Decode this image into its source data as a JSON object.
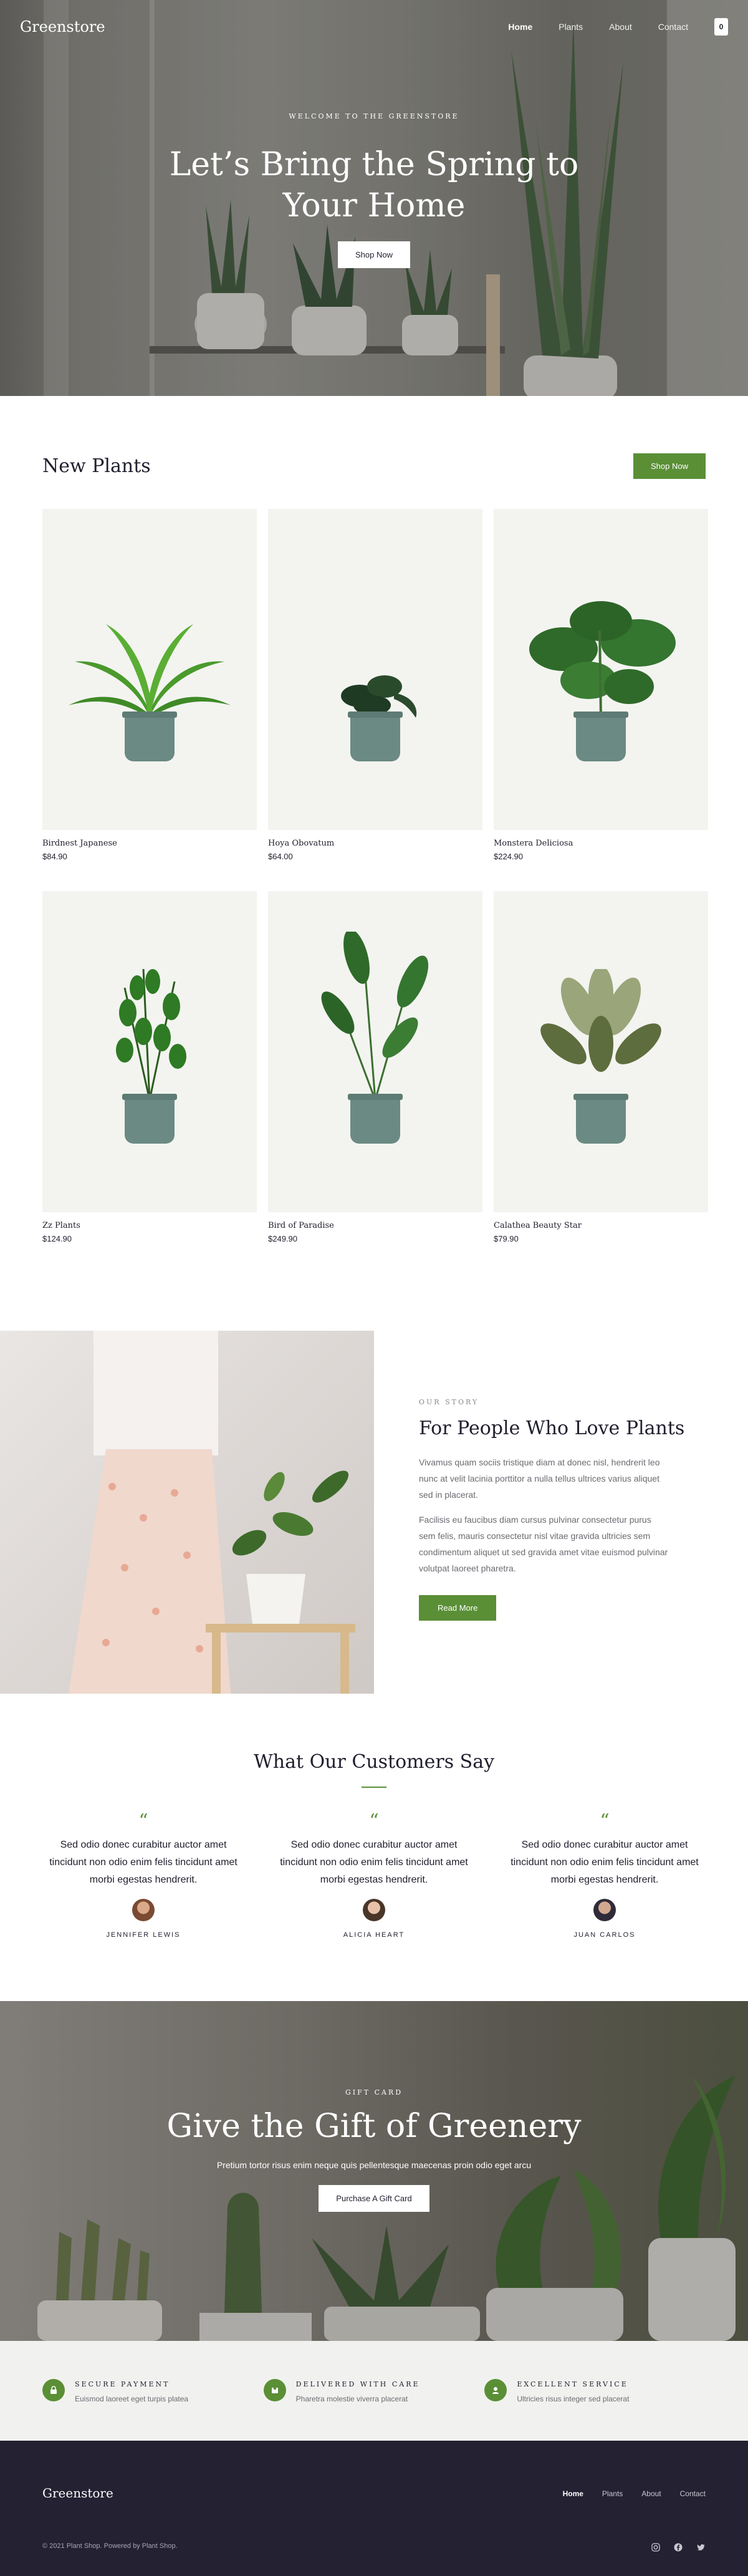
{
  "brand": {
    "logo": "Greenstore",
    "accent": "#5a8f36"
  },
  "nav": {
    "items": [
      {
        "label": "Home",
        "active": true
      },
      {
        "label": "Plants",
        "active": false
      },
      {
        "label": "About",
        "active": false
      },
      {
        "label": "Contact",
        "active": false
      }
    ],
    "cart_count": "0"
  },
  "hero": {
    "eyebrow": "WELCOME TO THE GREENSTORE",
    "title_line1": "Let’s Bring the Spring to",
    "title_line2": "Your Home",
    "button": "Shop Now"
  },
  "new_plants": {
    "title": "New Plants",
    "button": "Shop Now",
    "products": [
      {
        "name": "Birdnest Japanese",
        "price": "$84.90"
      },
      {
        "name": "Hoya Obovatum",
        "price": "$64.00"
      },
      {
        "name": "Monstera Deliciosa",
        "price": "$224.90"
      },
      {
        "name": "Zz Plants",
        "price": "$124.90"
      },
      {
        "name": "Bird of Paradise",
        "price": "$249.90"
      },
      {
        "name": "Calathea Beauty Star",
        "price": "$79.90"
      }
    ]
  },
  "story": {
    "eyebrow": "OUR STORY",
    "title": "For People Who Love Plants",
    "p1": "Vivamus quam sociis tristique diam at donec nisl, hendrerit leo nunc at velit lacinia porttitor a nulla tellus ultrices varius aliquet sed in placerat.",
    "p2": "Facilisis eu faucibus diam cursus pulvinar consectetur purus sem felis, mauris consectetur nisl vitae gravida ultricies sem condimentum aliquet ut sed gravida amet vitae euismod pulvinar volutpat laoreet pharetra.",
    "button": "Read More"
  },
  "testimonials": {
    "title": "What Our Customers Say",
    "items": [
      {
        "quote": "Sed odio donec curabitur auctor amet tincidunt non odio enim felis tincidunt amet morbi egestas hendrerit.",
        "name": "JENNIFER LEWIS"
      },
      {
        "quote": "Sed odio donec curabitur auctor amet tincidunt non odio enim felis tincidunt amet morbi egestas hendrerit.",
        "name": "ALICIA HEART"
      },
      {
        "quote": "Sed odio donec curabitur auctor amet tincidunt non odio enim felis tincidunt amet morbi egestas hendrerit.",
        "name": "JUAN CARLOS"
      }
    ]
  },
  "gift": {
    "eyebrow": "GIFT CARD",
    "title": "Give the Gift of Greenery",
    "subtitle": "Pretium tortor risus enim neque quis pellentesque maecenas proin odio eget arcu",
    "button": "Purchase A Gift Card"
  },
  "features": [
    {
      "title": "SECURE PAYMENT",
      "text": "Euismod laoreet eget turpis platea",
      "icon": "lock-icon"
    },
    {
      "title": "DELIVERED WITH CARE",
      "text": "Pharetra molestie viverra placerat",
      "icon": "box-icon"
    },
    {
      "title": "EXCELLENT SERVICE",
      "text": "Ultricies risus integer sed placerat",
      "icon": "support-icon"
    }
  ],
  "footer": {
    "logo": "Greenstore",
    "nav": [
      {
        "label": "Home",
        "active": true
      },
      {
        "label": "Plants",
        "active": false
      },
      {
        "label": "About",
        "active": false
      },
      {
        "label": "Contact",
        "active": false
      }
    ],
    "copyright": "© 2021 Plant Shop. Powered by Plant Shop."
  }
}
